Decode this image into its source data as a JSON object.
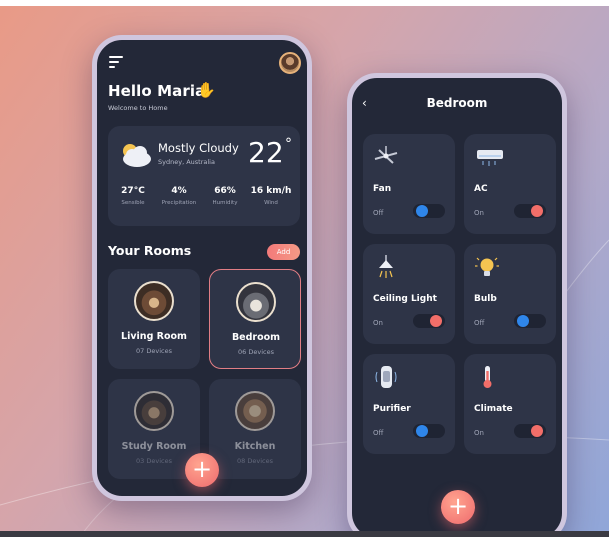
{
  "colors": {
    "card_bg": "#2e3447",
    "phone_bg": "#232838",
    "accent_coral": "#f26e69",
    "toggle_off_blue": "#2f86ea"
  },
  "home": {
    "greeting": "Hello Maria",
    "wave_icon": "waving-hand-icon",
    "subtitle": "Welcome to Home",
    "weather": {
      "condition": "Mostly Cloudy",
      "location": "Sydney, Australia",
      "temperature": "22",
      "degree_symbol": "°",
      "icon": "cloud-sun-icon",
      "stats": [
        {
          "value": "27°C",
          "label": "Sensible"
        },
        {
          "value": "4%",
          "label": "Precipitation"
        },
        {
          "value": "66%",
          "label": "Humidity"
        },
        {
          "value": "16 km/h",
          "label": "Wind"
        }
      ]
    },
    "rooms_title": "Your Rooms",
    "add_label": "Add",
    "rooms": [
      {
        "name": "Living Room",
        "devices": "07 Devices"
      },
      {
        "name": "Bedroom",
        "devices": "06 Devices",
        "selected": true
      },
      {
        "name": "Study Room",
        "devices": "03 Devices"
      },
      {
        "name": "Kitchen",
        "devices": "08 Devices"
      }
    ],
    "fab_label": "+"
  },
  "bedroom": {
    "back_label": "‹",
    "title": "Bedroom",
    "devices": [
      {
        "name": "Fan",
        "state": "Off",
        "icon": "ceiling-fan-icon",
        "on": false
      },
      {
        "name": "AC",
        "state": "On",
        "icon": "air-conditioner-icon",
        "on": true
      },
      {
        "name": "Ceiling Light",
        "state": "On",
        "icon": "ceiling-lamp-icon",
        "on": true
      },
      {
        "name": "Bulb",
        "state": "Off",
        "icon": "light-bulb-icon",
        "on": false
      },
      {
        "name": "Purifier",
        "state": "Off",
        "icon": "air-purifier-icon",
        "on": false
      },
      {
        "name": "Climate",
        "state": "On",
        "icon": "thermometer-icon",
        "on": true
      }
    ],
    "fab_label": "+"
  }
}
